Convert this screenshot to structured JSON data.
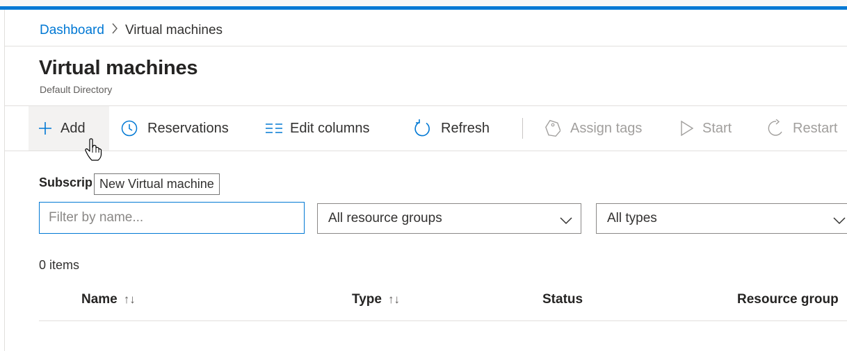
{
  "breadcrumb": {
    "items": [
      "Dashboard",
      "Virtual machines"
    ],
    "separator": ">"
  },
  "page": {
    "title": "Virtual machines",
    "subtitle": "Default Directory"
  },
  "toolbar": {
    "items": [
      {
        "label": "Add",
        "icon": "plus-icon",
        "state": "hover"
      },
      {
        "label": "Reservations",
        "icon": "clock-icon",
        "state": "enabled"
      },
      {
        "label": "Edit columns",
        "icon": "columns-icon",
        "state": "enabled"
      },
      {
        "label": "Refresh",
        "icon": "refresh-icon",
        "state": "enabled"
      },
      {
        "label": "Assign tags",
        "icon": "tag-icon",
        "state": "disabled"
      },
      {
        "label": "Start",
        "icon": "play-icon",
        "state": "disabled"
      },
      {
        "label": "Restart",
        "icon": "restart-icon",
        "state": "disabled"
      }
    ]
  },
  "tooltip": {
    "text": "New Virtual machine"
  },
  "filters": {
    "subscriptions_label": "Subscriptions",
    "name_placeholder": "Filter by name...",
    "name_value": "",
    "resource_group": "All resource groups",
    "type": "All types"
  },
  "list": {
    "count_text": "0 items",
    "columns": [
      {
        "label": "Name",
        "sortable": true
      },
      {
        "label": "Type",
        "sortable": true
      },
      {
        "label": "Status",
        "sortable": false
      },
      {
        "label": "Resource group",
        "sortable": false
      }
    ],
    "rows": []
  },
  "colors": {
    "accent": "#0078d4",
    "text": "#323130",
    "disabled": "#a19f9d",
    "border": "#e1dfdd"
  }
}
